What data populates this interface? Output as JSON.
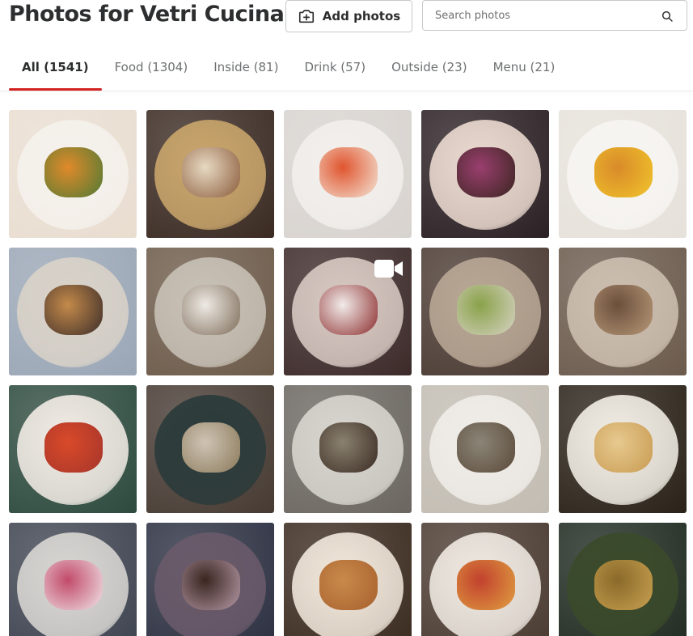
{
  "header": {
    "title": "Photos for Vetri Cucina",
    "add_photos_label": "Add photos",
    "search_placeholder": "Search photos"
  },
  "tabs": [
    {
      "label": "All (1541)",
      "active": true
    },
    {
      "label": "Food (1304)",
      "active": false
    },
    {
      "label": "Inside (81)",
      "active": false
    },
    {
      "label": "Drink (57)",
      "active": false
    },
    {
      "label": "Outside (23)",
      "active": false
    },
    {
      "label": "Menu (21)",
      "active": false
    }
  ],
  "colors": {
    "accent": "#d32323",
    "text": "#2d2e2f",
    "muted": "#6e7072",
    "border": "#c8c9ca"
  },
  "photos": [
    {
      "name": "photo-soup-plate",
      "bg": "#e9ddd0",
      "plate": "#f5f1ec",
      "food": "#e08a2a",
      "accent": "#4f7a35",
      "video": false
    },
    {
      "name": "photo-dining-room",
      "bg": "#3a2a22",
      "plate": "#c9a56b",
      "food": "#e7d9c2",
      "accent": "#8a5a3a",
      "video": false
    },
    {
      "name": "photo-toast-squares",
      "bg": "#d8d3cf",
      "plate": "#f2efec",
      "food": "#e0552f",
      "accent": "#f4e6d8",
      "video": false
    },
    {
      "name": "photo-endive-dessert",
      "bg": "#2b2024",
      "plate": "#ead9cf",
      "food": "#9a3f6e",
      "accent": "#3a2520",
      "video": false
    },
    {
      "name": "photo-tart-gelato",
      "bg": "#e6e1da",
      "plate": "#f7f5f2",
      "food": "#d98a2a",
      "accent": "#f1c52b",
      "video": false
    },
    {
      "name": "photo-foie-gras-toast",
      "bg": "#9aa6b6",
      "plate": "#d9d2c8",
      "food": "#c48a4a",
      "accent": "#3b2d2a",
      "video": false
    },
    {
      "name": "photo-oysters",
      "bg": "#6c5a49",
      "plate": "#c8c1b6",
      "food": "#eeeae4",
      "accent": "#7d6b58",
      "video": false
    },
    {
      "name": "photo-teapot-video",
      "bg": "#3c2a29",
      "plate": "#d8c8c2",
      "food": "#f1ecea",
      "accent": "#8b2b2b",
      "video": true
    },
    {
      "name": "photo-greens-plate",
      "bg": "#4a3a32",
      "plate": "#b9a795",
      "food": "#8aa24a",
      "accent": "#d7d3c4",
      "video": false
    },
    {
      "name": "photo-truffle-dish",
      "bg": "#6b5a4c",
      "plate": "#cdbfb0",
      "food": "#6a4f3b",
      "accent": "#b89878",
      "video": false
    },
    {
      "name": "photo-spaghetti",
      "bg": "#2d4a3e",
      "plate": "#f1ebe4",
      "food": "#d94a2a",
      "accent": "#a6352b",
      "video": false
    },
    {
      "name": "photo-tray-glasses",
      "bg": "#463a32",
      "plate": "#2a3a3a",
      "food": "#cfc3b4",
      "accent": "#8a7a5a",
      "video": false
    },
    {
      "name": "photo-artichoke",
      "bg": "#6b6660",
      "plate": "#d8d5cf",
      "food": "#8a8270",
      "accent": "#3a2a22",
      "video": false
    },
    {
      "name": "photo-terrine",
      "bg": "#c2bcb2",
      "plate": "#f0ede9",
      "food": "#8b8577",
      "accent": "#5b4a3a",
      "video": false
    },
    {
      "name": "photo-pasta-truffle",
      "bg": "#2a2218",
      "plate": "#f1ede4",
      "food": "#e7c98f",
      "accent": "#c89b52",
      "video": false
    },
    {
      "name": "photo-beet-salad",
      "bg": "#3e4350",
      "plate": "#d8d6d2",
      "food": "#c24a6a",
      "accent": "#f0e6e8",
      "video": false
    },
    {
      "name": "photo-chocolate-cake",
      "bg": "#2b2f40",
      "plate": "#6a5a6a",
      "food": "#3a2620",
      "accent": "#b79aa8",
      "video": false
    },
    {
      "name": "photo-pappardelle",
      "bg": "#3a2a1e",
      "plate": "#f0e6da",
      "food": "#c88a4a",
      "accent": "#a8602e",
      "video": false
    },
    {
      "name": "photo-tartare-ravioli",
      "bg": "#4a3a30",
      "plate": "#efe9e2",
      "food": "#c2412e",
      "accent": "#e0a040",
      "video": false
    },
    {
      "name": "photo-alley-night",
      "bg": "#1f2a20",
      "plate": "#3a4a2a",
      "food": "#8a6a2a",
      "accent": "#c8a050",
      "video": false
    }
  ]
}
